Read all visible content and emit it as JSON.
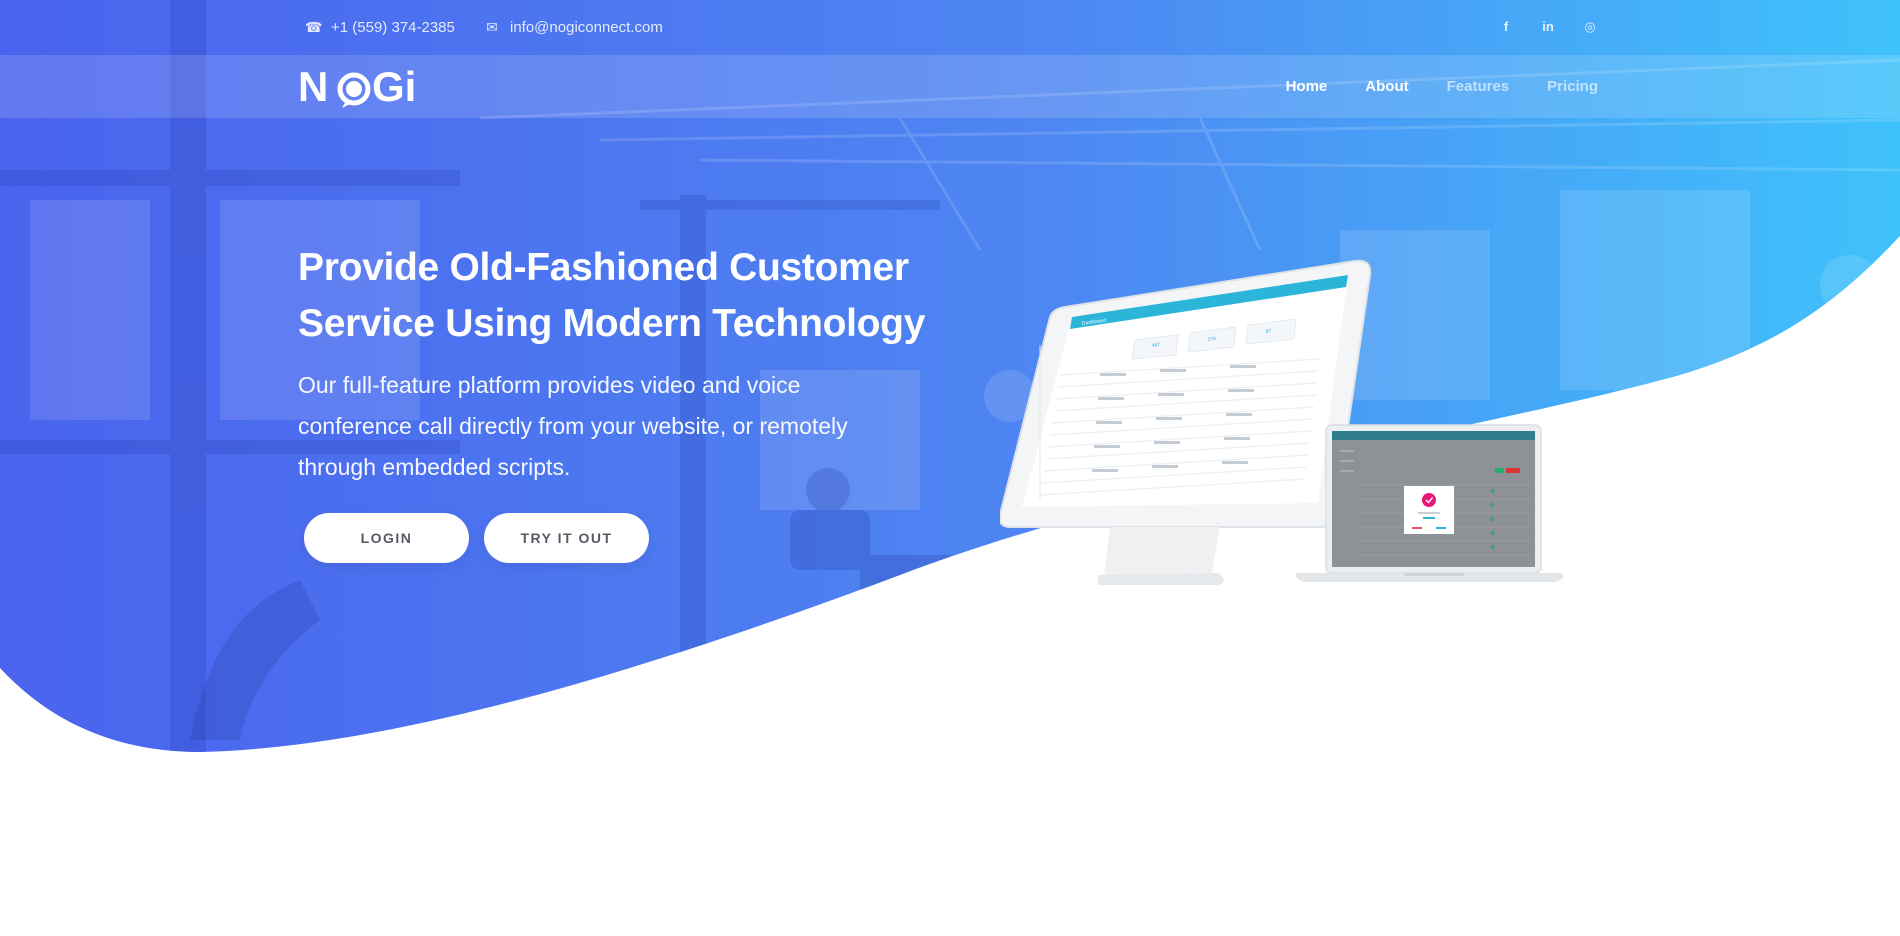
{
  "topbar": {
    "phone": "+1 (559) 374-2385",
    "email": "info@nogiconnect.com",
    "phone_icon": "phone-icon",
    "email_icon": "envelope-icon",
    "socials": [
      {
        "icon": "facebook-icon",
        "glyph": "f"
      },
      {
        "icon": "linkedin-icon",
        "glyph": "in"
      },
      {
        "icon": "instagram-icon",
        "glyph": "◎"
      }
    ]
  },
  "brand": {
    "logo_text": "NoGi"
  },
  "nav": {
    "items": [
      {
        "label": "Home",
        "active": true
      },
      {
        "label": "About",
        "active": true
      },
      {
        "label": "Features",
        "active": false
      },
      {
        "label": "Pricing",
        "active": false
      }
    ]
  },
  "hero": {
    "headline_line1": "Provide Old-Fashioned Customer",
    "headline_line2": "Service Using Modern Technology",
    "sub_line1": "Our full-feature platform provides video and voice",
    "sub_line2": "conference call directly from your website, or remotely",
    "sub_line3": "through embedded scripts.",
    "login_label": "LOGIN",
    "try_label": "TRY IT OUT"
  },
  "mockup": {
    "monitor_title": "Dashboard",
    "stats": [
      "467",
      "276",
      "87"
    ]
  },
  "colors": {
    "gradient_start": "#4a63ee",
    "gradient_end": "#3fc2fb",
    "button_text": "#555a66"
  }
}
